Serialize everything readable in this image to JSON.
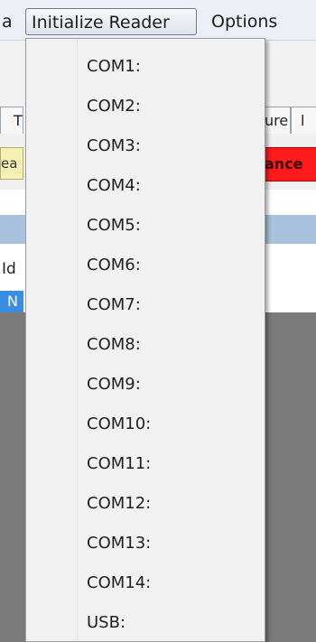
{
  "menubar": {
    "cut_label": "a",
    "initialize_reader": "Initialize Reader",
    "options": "Options"
  },
  "background": {
    "tab_left": "T",
    "tab_right": "ure",
    "tab_far": "l",
    "button_yellow": "ea",
    "button_red": "ance",
    "row_text": "Id",
    "selected_cell": "N"
  },
  "dropdown": {
    "items": [
      "COM1:",
      "COM2:",
      "COM3:",
      "COM4:",
      "COM5:",
      "COM6:",
      "COM7:",
      "COM8:",
      "COM9:",
      "COM10:",
      "COM11:",
      "COM12:",
      "COM13:",
      "COM14:",
      "USB:"
    ]
  }
}
